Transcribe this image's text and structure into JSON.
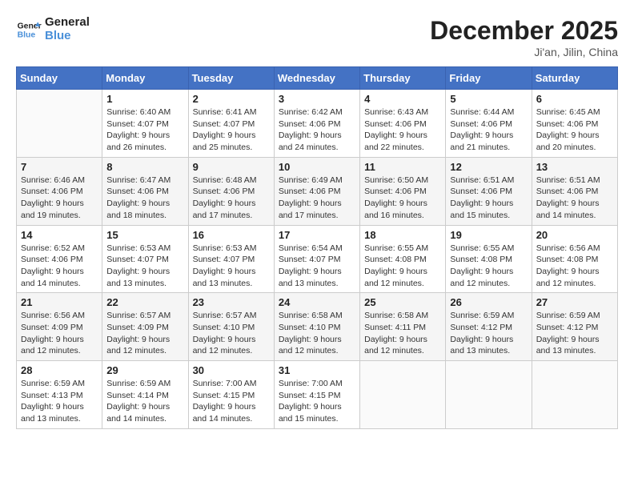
{
  "logo": {
    "line1": "General",
    "line2": "Blue"
  },
  "title": "December 2025",
  "location": "Ji'an, Jilin, China",
  "weekdays": [
    "Sunday",
    "Monday",
    "Tuesday",
    "Wednesday",
    "Thursday",
    "Friday",
    "Saturday"
  ],
  "weeks": [
    [
      {
        "day": null
      },
      {
        "day": 1,
        "sunrise": "6:40 AM",
        "sunset": "4:07 PM",
        "daylight": "9 hours and 26 minutes."
      },
      {
        "day": 2,
        "sunrise": "6:41 AM",
        "sunset": "4:07 PM",
        "daylight": "9 hours and 25 minutes."
      },
      {
        "day": 3,
        "sunrise": "6:42 AM",
        "sunset": "4:06 PM",
        "daylight": "9 hours and 24 minutes."
      },
      {
        "day": 4,
        "sunrise": "6:43 AM",
        "sunset": "4:06 PM",
        "daylight": "9 hours and 22 minutes."
      },
      {
        "day": 5,
        "sunrise": "6:44 AM",
        "sunset": "4:06 PM",
        "daylight": "9 hours and 21 minutes."
      },
      {
        "day": 6,
        "sunrise": "6:45 AM",
        "sunset": "4:06 PM",
        "daylight": "9 hours and 20 minutes."
      }
    ],
    [
      {
        "day": 7,
        "sunrise": "6:46 AM",
        "sunset": "4:06 PM",
        "daylight": "9 hours and 19 minutes."
      },
      {
        "day": 8,
        "sunrise": "6:47 AM",
        "sunset": "4:06 PM",
        "daylight": "9 hours and 18 minutes."
      },
      {
        "day": 9,
        "sunrise": "6:48 AM",
        "sunset": "4:06 PM",
        "daylight": "9 hours and 17 minutes."
      },
      {
        "day": 10,
        "sunrise": "6:49 AM",
        "sunset": "4:06 PM",
        "daylight": "9 hours and 17 minutes."
      },
      {
        "day": 11,
        "sunrise": "6:50 AM",
        "sunset": "4:06 PM",
        "daylight": "9 hours and 16 minutes."
      },
      {
        "day": 12,
        "sunrise": "6:51 AM",
        "sunset": "4:06 PM",
        "daylight": "9 hours and 15 minutes."
      },
      {
        "day": 13,
        "sunrise": "6:51 AM",
        "sunset": "4:06 PM",
        "daylight": "9 hours and 14 minutes."
      }
    ],
    [
      {
        "day": 14,
        "sunrise": "6:52 AM",
        "sunset": "4:06 PM",
        "daylight": "9 hours and 14 minutes."
      },
      {
        "day": 15,
        "sunrise": "6:53 AM",
        "sunset": "4:07 PM",
        "daylight": "9 hours and 13 minutes."
      },
      {
        "day": 16,
        "sunrise": "6:53 AM",
        "sunset": "4:07 PM",
        "daylight": "9 hours and 13 minutes."
      },
      {
        "day": 17,
        "sunrise": "6:54 AM",
        "sunset": "4:07 PM",
        "daylight": "9 hours and 13 minutes."
      },
      {
        "day": 18,
        "sunrise": "6:55 AM",
        "sunset": "4:08 PM",
        "daylight": "9 hours and 12 minutes."
      },
      {
        "day": 19,
        "sunrise": "6:55 AM",
        "sunset": "4:08 PM",
        "daylight": "9 hours and 12 minutes."
      },
      {
        "day": 20,
        "sunrise": "6:56 AM",
        "sunset": "4:08 PM",
        "daylight": "9 hours and 12 minutes."
      }
    ],
    [
      {
        "day": 21,
        "sunrise": "6:56 AM",
        "sunset": "4:09 PM",
        "daylight": "9 hours and 12 minutes."
      },
      {
        "day": 22,
        "sunrise": "6:57 AM",
        "sunset": "4:09 PM",
        "daylight": "9 hours and 12 minutes."
      },
      {
        "day": 23,
        "sunrise": "6:57 AM",
        "sunset": "4:10 PM",
        "daylight": "9 hours and 12 minutes."
      },
      {
        "day": 24,
        "sunrise": "6:58 AM",
        "sunset": "4:10 PM",
        "daylight": "9 hours and 12 minutes."
      },
      {
        "day": 25,
        "sunrise": "6:58 AM",
        "sunset": "4:11 PM",
        "daylight": "9 hours and 12 minutes."
      },
      {
        "day": 26,
        "sunrise": "6:59 AM",
        "sunset": "4:12 PM",
        "daylight": "9 hours and 13 minutes."
      },
      {
        "day": 27,
        "sunrise": "6:59 AM",
        "sunset": "4:12 PM",
        "daylight": "9 hours and 13 minutes."
      }
    ],
    [
      {
        "day": 28,
        "sunrise": "6:59 AM",
        "sunset": "4:13 PM",
        "daylight": "9 hours and 13 minutes."
      },
      {
        "day": 29,
        "sunrise": "6:59 AM",
        "sunset": "4:14 PM",
        "daylight": "9 hours and 14 minutes."
      },
      {
        "day": 30,
        "sunrise": "7:00 AM",
        "sunset": "4:15 PM",
        "daylight": "9 hours and 14 minutes."
      },
      {
        "day": 31,
        "sunrise": "7:00 AM",
        "sunset": "4:15 PM",
        "daylight": "9 hours and 15 minutes."
      },
      {
        "day": null
      },
      {
        "day": null
      },
      {
        "day": null
      }
    ]
  ]
}
